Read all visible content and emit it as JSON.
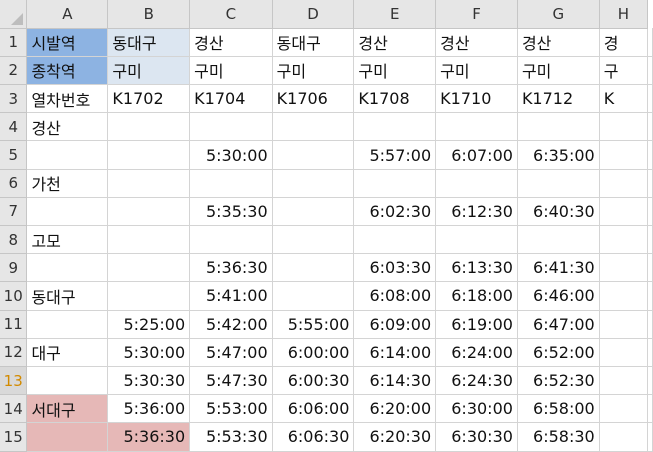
{
  "columns": [
    "A",
    "B",
    "C",
    "D",
    "E",
    "F",
    "G",
    "H"
  ],
  "active_row": "13",
  "colors": {
    "origin_label_bg": "#8db3e2",
    "origin_value_bg": "#dce6f1",
    "highlight_bg": "#e6b8b7",
    "active_row_header": "#d28a00"
  },
  "rows": [
    {
      "n": "1",
      "cells": [
        "시발역",
        "동대구",
        "경산",
        "동대구",
        "경산",
        "경산",
        "경산",
        "경"
      ]
    },
    {
      "n": "2",
      "cells": [
        "종착역",
        "구미",
        "구미",
        "구미",
        "구미",
        "구미",
        "구미",
        "구"
      ]
    },
    {
      "n": "3",
      "cells": [
        "열차번호",
        "K1702",
        "K1704",
        "K1706",
        "K1708",
        "K1710",
        "K1712",
        "K"
      ]
    },
    {
      "n": "4",
      "cells": [
        "경산",
        "",
        "",
        "",
        "",
        "",
        "",
        ""
      ]
    },
    {
      "n": "5",
      "cells": [
        "",
        "",
        "5:30:00",
        "",
        "5:57:00",
        "6:07:00",
        "6:35:00",
        ""
      ]
    },
    {
      "n": "6",
      "cells": [
        "가천",
        "",
        "",
        "",
        "",
        "",
        "",
        ""
      ]
    },
    {
      "n": "7",
      "cells": [
        "",
        "",
        "5:35:30",
        "",
        "6:02:30",
        "6:12:30",
        "6:40:30",
        ""
      ]
    },
    {
      "n": "8",
      "cells": [
        "고모",
        "",
        "",
        "",
        "",
        "",
        "",
        ""
      ]
    },
    {
      "n": "9",
      "cells": [
        "",
        "",
        "5:36:30",
        "",
        "6:03:30",
        "6:13:30",
        "6:41:30",
        ""
      ]
    },
    {
      "n": "10",
      "cells": [
        "동대구",
        "",
        "5:41:00",
        "",
        "6:08:00",
        "6:18:00",
        "6:46:00",
        ""
      ]
    },
    {
      "n": "11",
      "cells": [
        "",
        "5:25:00",
        "5:42:00",
        "5:55:00",
        "6:09:00",
        "6:19:00",
        "6:47:00",
        ""
      ]
    },
    {
      "n": "12",
      "cells": [
        "대구",
        "5:30:00",
        "5:47:00",
        "6:00:00",
        "6:14:00",
        "6:24:00",
        "6:52:00",
        ""
      ]
    },
    {
      "n": "13",
      "cells": [
        "",
        "5:30:30",
        "5:47:30",
        "6:00:30",
        "6:14:30",
        "6:24:30",
        "6:52:30",
        ""
      ]
    },
    {
      "n": "14",
      "cells": [
        "서대구",
        "5:36:00",
        "5:53:00",
        "6:06:00",
        "6:20:00",
        "6:30:00",
        "6:58:00",
        ""
      ]
    },
    {
      "n": "15",
      "cells": [
        "",
        "5:36:30",
        "5:53:30",
        "6:06:30",
        "6:20:30",
        "6:30:30",
        "6:58:30",
        ""
      ]
    }
  ]
}
